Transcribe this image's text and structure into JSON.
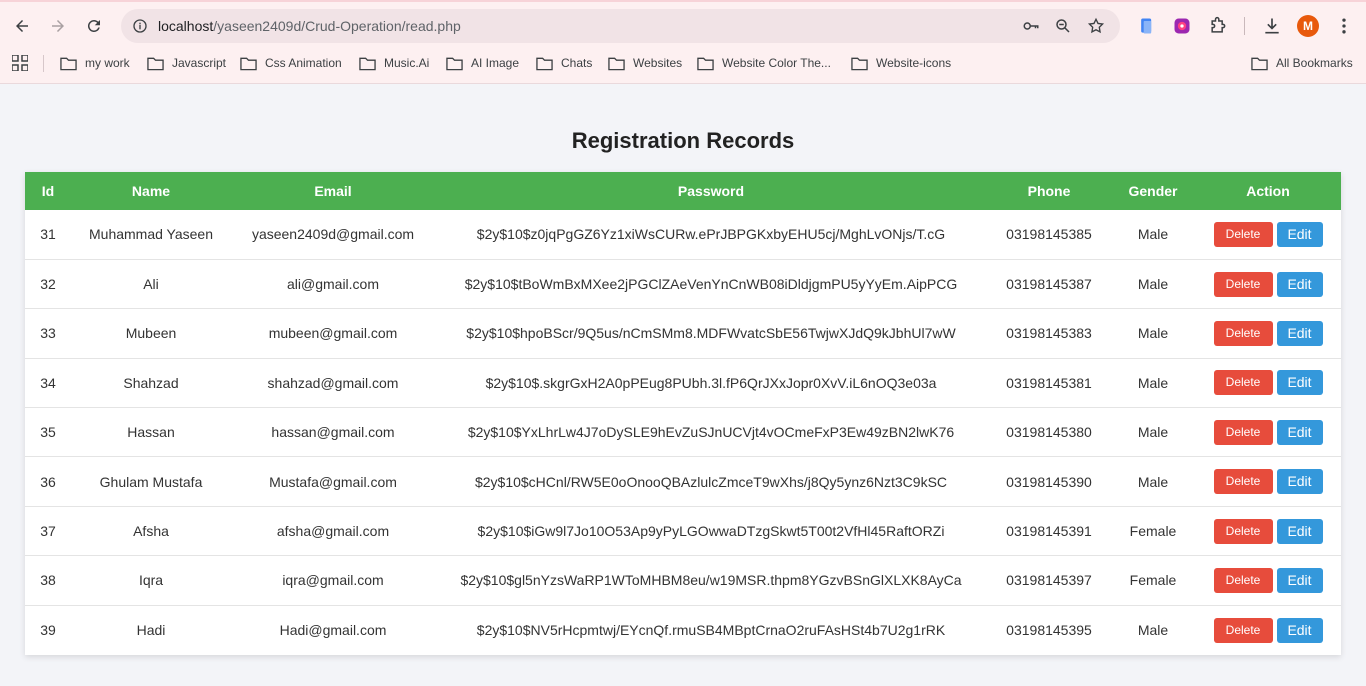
{
  "browser": {
    "url_host": "localhost",
    "url_path": "/yaseen2409d/Crud-Operation/read.php",
    "profile_initial": "M",
    "colors": {
      "profile": "#e8590c"
    }
  },
  "bookmarks": {
    "items": [
      {
        "label": "my work"
      },
      {
        "label": "Javascript"
      },
      {
        "label": "Css Animation"
      },
      {
        "label": "Music.Ai"
      },
      {
        "label": "AI Image"
      },
      {
        "label": "Chats"
      },
      {
        "label": "Websites"
      },
      {
        "label": "Website Color The..."
      },
      {
        "label": "Website-icons"
      }
    ],
    "all_label": "All Bookmarks"
  },
  "page": {
    "title": "Registration Records",
    "colors": {
      "header": "#4caf50",
      "delete": "#e74c3c",
      "edit": "#3498db"
    }
  },
  "table": {
    "headers": [
      "Id",
      "Name",
      "Email",
      "Password",
      "Phone",
      "Gender",
      "Action"
    ],
    "delete_label": "Delete",
    "edit_label": "Edit",
    "rows": [
      {
        "id": "31",
        "name": "Muhammad Yaseen",
        "email": "yaseen2409d@gmail.com",
        "password": "$2y$10$z0jqPgGZ6Yz1xiWsCURw.ePrJBPGKxbyEHU5cj/MghLvONjs/T.cG",
        "phone": "03198145385",
        "gender": "Male"
      },
      {
        "id": "32",
        "name": "Ali",
        "email": "ali@gmail.com",
        "password": "$2y$10$tBoWmBxMXee2jPGClZAeVenYnCnWB08iDldjgmPU5yYyEm.AipPCG",
        "phone": "03198145387",
        "gender": "Male"
      },
      {
        "id": "33",
        "name": "Mubeen",
        "email": "mubeen@gmail.com",
        "password": "$2y$10$hpoBScr/9Q5us/nCmSMm8.MDFWvatcSbE56TwjwXJdQ9kJbhUl7wW",
        "phone": "03198145383",
        "gender": "Male"
      },
      {
        "id": "34",
        "name": "Shahzad",
        "email": "shahzad@gmail.com",
        "password": "$2y$10$.skgrGxH2A0pPEug8PUbh.3l.fP6QrJXxJopr0XvV.iL6nOQ3e03a",
        "phone": "03198145381",
        "gender": "Male"
      },
      {
        "id": "35",
        "name": "Hassan",
        "email": "hassan@gmail.com",
        "password": "$2y$10$YxLhrLw4J7oDySLE9hEvZuSJnUCVjt4vOCmeFxP3Ew49zBN2lwK76",
        "phone": "03198145380",
        "gender": "Male"
      },
      {
        "id": "36",
        "name": "Ghulam Mustafa",
        "email": "Mustafa@gmail.com",
        "password": "$2y$10$cHCnl/RW5E0oOnooQBAzlulcZmceT9wXhs/j8Qy5ynz6Nzt3C9kSC",
        "phone": "03198145390",
        "gender": "Male"
      },
      {
        "id": "37",
        "name": "Afsha",
        "email": "afsha@gmail.com",
        "password": "$2y$10$iGw9l7Jo10O53Ap9yPyLGOwwaDTzgSkwt5T00t2VfHl45RaftORZi",
        "phone": "03198145391",
        "gender": "Female"
      },
      {
        "id": "38",
        "name": "Iqra",
        "email": "iqra@gmail.com",
        "password": "$2y$10$gl5nYzsWaRP1WToMHBM8eu/w19MSR.thpm8YGzvBSnGlXLXK8AyCa",
        "phone": "03198145397",
        "gender": "Female"
      },
      {
        "id": "39",
        "name": "Hadi",
        "email": "Hadi@gmail.com",
        "password": "$2y$10$NV5rHcpmtwj/EYcnQf.rmuSB4MBptCrnaO2ruFAsHSt4b7U2g1rRK",
        "phone": "03198145395",
        "gender": "Male"
      }
    ]
  }
}
